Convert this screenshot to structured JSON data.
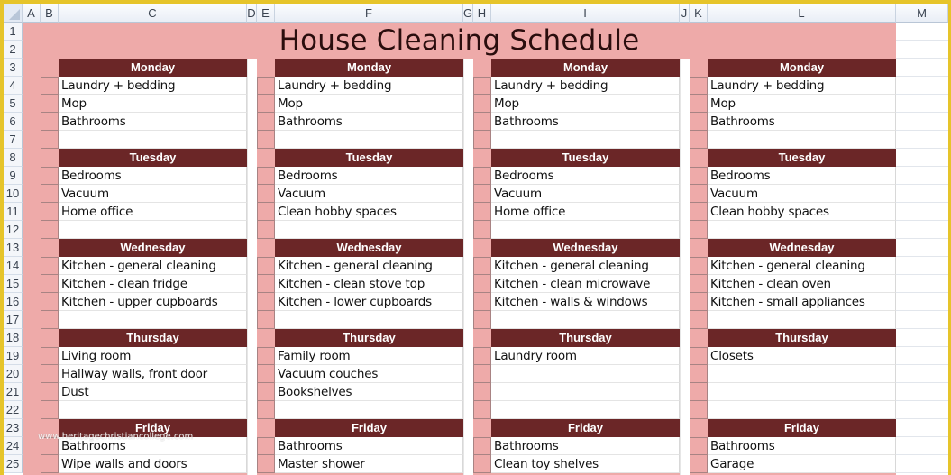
{
  "spreadsheet": {
    "columns": [
      "A",
      "B",
      "C",
      "D",
      "E",
      "F",
      "G",
      "H",
      "I",
      "J",
      "K",
      "L",
      "M"
    ],
    "rows": [
      "1",
      "2",
      "3",
      "4",
      "5",
      "6",
      "7",
      "8",
      "9",
      "10",
      "11",
      "12",
      "13",
      "14",
      "15",
      "16",
      "17",
      "18",
      "19",
      "20",
      "21",
      "22",
      "23",
      "24",
      "25"
    ]
  },
  "title": "House Cleaning Schedule",
  "colors": {
    "background_pink": "#eeaaa9",
    "day_header": "#6b2627",
    "title_text": "#2a0d0d"
  },
  "weeks": [
    {
      "days": [
        {
          "day": "Monday",
          "tasks": [
            "Laundry + bedding",
            "Mop",
            "Bathrooms",
            ""
          ]
        },
        {
          "day": "Tuesday",
          "tasks": [
            "Bedrooms",
            "Vacuum",
            "Home office",
            ""
          ]
        },
        {
          "day": "Wednesday",
          "tasks": [
            "Kitchen - general cleaning",
            "Kitchen - clean fridge",
            "Kitchen - upper cupboards",
            ""
          ]
        },
        {
          "day": "Thursday",
          "tasks": [
            "Living room",
            "Hallway walls, front door",
            "Dust",
            ""
          ]
        },
        {
          "day": "Friday",
          "tasks": [
            "Bathrooms",
            "Wipe walls and doors"
          ]
        }
      ]
    },
    {
      "days": [
        {
          "day": "Monday",
          "tasks": [
            "Laundry + bedding",
            "Mop",
            "Bathrooms",
            ""
          ]
        },
        {
          "day": "Tuesday",
          "tasks": [
            "Bedrooms",
            "Vacuum",
            "Clean hobby spaces",
            ""
          ]
        },
        {
          "day": "Wednesday",
          "tasks": [
            "Kitchen - general cleaning",
            "Kitchen - clean stove top",
            "Kitchen - lower cupboards",
            ""
          ]
        },
        {
          "day": "Thursday",
          "tasks": [
            "Family room",
            "Vacuum couches",
            "Bookshelves",
            ""
          ]
        },
        {
          "day": "Friday",
          "tasks": [
            "Bathrooms",
            "Master shower"
          ]
        }
      ]
    },
    {
      "days": [
        {
          "day": "Monday",
          "tasks": [
            "Laundry + bedding",
            "Mop",
            "Bathrooms",
            ""
          ]
        },
        {
          "day": "Tuesday",
          "tasks": [
            "Bedrooms",
            "Vacuum",
            "Home office",
            ""
          ]
        },
        {
          "day": "Wednesday",
          "tasks": [
            "Kitchen - general cleaning",
            "Kitchen - clean microwave",
            "Kitchen - walls & windows",
            ""
          ]
        },
        {
          "day": "Thursday",
          "tasks": [
            "Laundry room",
            "",
            "",
            ""
          ]
        },
        {
          "day": "Friday",
          "tasks": [
            "Bathrooms",
            "Clean toy shelves"
          ]
        }
      ]
    },
    {
      "days": [
        {
          "day": "Monday",
          "tasks": [
            "Laundry + bedding",
            "Mop",
            "Bathrooms",
            ""
          ]
        },
        {
          "day": "Tuesday",
          "tasks": [
            "Bedrooms",
            "Vacuum",
            "Clean hobby spaces",
            ""
          ]
        },
        {
          "day": "Wednesday",
          "tasks": [
            "Kitchen - general cleaning",
            "Kitchen - clean oven",
            "Kitchen - small appliances",
            ""
          ]
        },
        {
          "day": "Thursday",
          "tasks": [
            "Closets",
            "",
            "",
            ""
          ]
        },
        {
          "day": "Friday",
          "tasks": [
            "Bathrooms",
            "Garage"
          ]
        }
      ]
    }
  ],
  "watermark": "www.heritagechristiancollege.com"
}
